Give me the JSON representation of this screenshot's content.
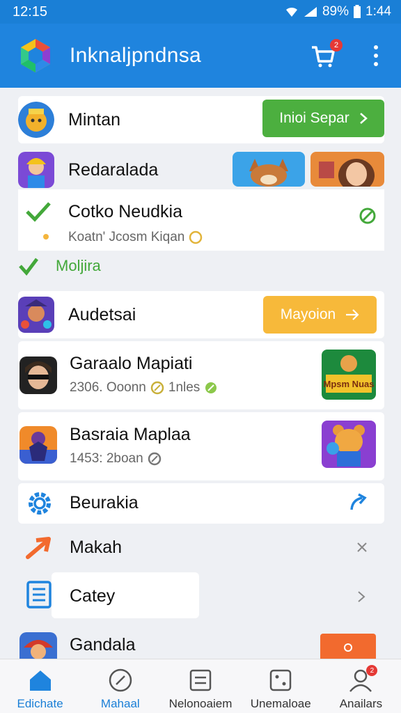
{
  "status": {
    "time": "12:15",
    "battery": "89%",
    "clock": "1:44"
  },
  "appbar": {
    "title": "Inknaljpndnsa",
    "cart_badge": "2"
  },
  "items": {
    "mintan": {
      "title": "Mintan",
      "button": "Inioi Separ"
    },
    "redaralada": {
      "title": "Redaralada"
    },
    "cotko": {
      "title": "Cotko Neudkia",
      "subtitle": "Koatn' Jcosm Kiqan"
    },
    "section": {
      "label": "Moljira"
    },
    "audetsai": {
      "title": "Audetsai",
      "button": "Mayoion"
    },
    "garaalo": {
      "title": "Garaalo Mapiati",
      "subtitle": "2306. Ooonn",
      "extra": "1nles"
    },
    "basraia": {
      "title": "Basraia Maplaa",
      "subtitle": "1453: 2boan"
    },
    "beurakia": {
      "title": "Beurakia"
    },
    "makah": {
      "title": "Makah"
    },
    "catey": {
      "title": "Catey"
    },
    "gandala": {
      "title": "Gandala"
    }
  },
  "thumbs": {
    "game_logo_text": "Mpsm Nuas"
  },
  "nav": [
    {
      "label": "Edichate"
    },
    {
      "label": "Mahaal"
    },
    {
      "label": "Nelonoaiem"
    },
    {
      "label": "Unemaloae"
    },
    {
      "label": "Anailars",
      "badge": "2"
    }
  ],
  "colors": {
    "primary": "#1f84de",
    "green": "#4caf3f",
    "yellow": "#f7b93a",
    "orange": "#f26a2e"
  }
}
